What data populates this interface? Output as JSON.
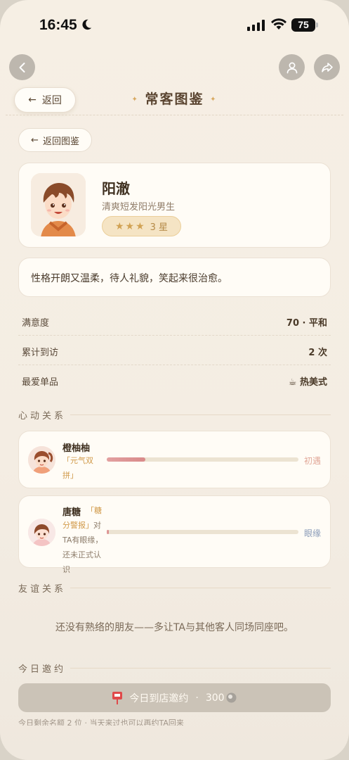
{
  "status_bar": {
    "time": "16:45",
    "battery": "75"
  },
  "header": {
    "back_label": "返回",
    "title": "常客图鉴",
    "back_gallery_label": "返回图鉴"
  },
  "profile": {
    "name": "阳澈",
    "description": "清爽短发阳光男生",
    "stars_text": "3 星",
    "star_count": 3,
    "bio": "性格开朗又温柔，待人礼貌，笑起来很治愈。"
  },
  "stats": [
    {
      "label": "满意度",
      "value": "70 · 平和"
    },
    {
      "label": "累计到访",
      "value": "2 次"
    },
    {
      "label": "最爱单品",
      "value": "热美式",
      "icon": "coffee-icon"
    }
  ],
  "sections": {
    "crush": "心动关系",
    "friend": "友谊关系",
    "invite": "今日邀约"
  },
  "relations": [
    {
      "name": "橙柚柚",
      "tag": "「元气双拼」",
      "note": "",
      "stage": "初遇",
      "progress": 0.2
    },
    {
      "name": "唐糖",
      "tag": "「糖分警报」",
      "note": "对TA有眼缘，还未正式认识",
      "stage": "眼缘",
      "progress": 0.0
    }
  ],
  "friend_empty": "还没有熟络的朋友——多让TA与其他客人同场同座吧。",
  "invite": {
    "label": "今日到店邀约",
    "cost": "300",
    "hint": "今日剩余名额 2 位 · 当天来过也可以再约TA回来"
  },
  "colors": {
    "accent_gold": "#d1a253",
    "stage_first": "#e2a99a",
    "stage_eye": "#8a9bb8",
    "button_disabled": "#cbc3b7"
  }
}
